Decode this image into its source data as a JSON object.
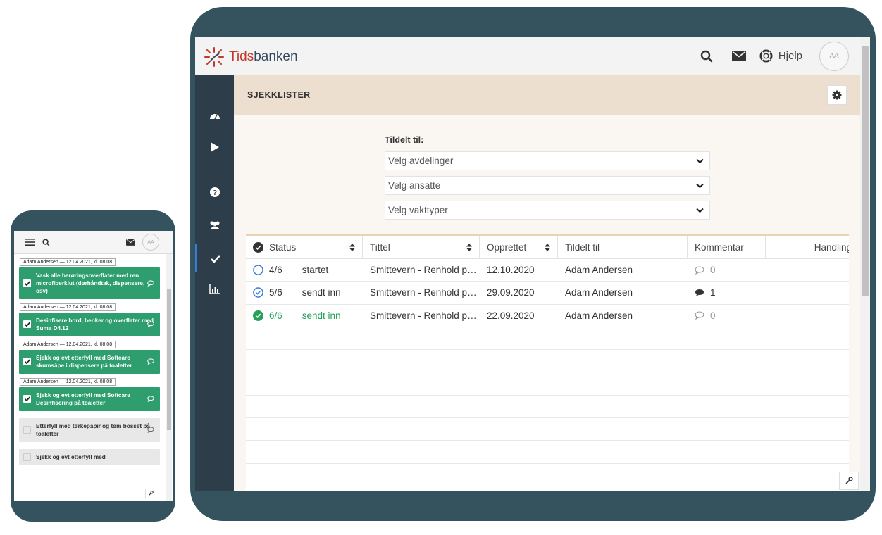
{
  "tablet": {
    "brand": {
      "part1": "Tids",
      "part2": "banken"
    },
    "topbar": {
      "search_icon": "search-icon",
      "mail_icon": "envelope-icon",
      "help_label": "Hjelp",
      "avatar": "AA"
    },
    "sidebar": [
      "dashboard-icon",
      "play-icon",
      "question-icon",
      "users-icon",
      "check-icon",
      "chart-icon"
    ],
    "page_title": "SJEKKLISTER",
    "filters": {
      "label": "Tildelt til:",
      "selects": [
        "Velg avdelinger",
        "Velg ansatte",
        "Velg vakttyper"
      ]
    },
    "table": {
      "headers": [
        "Status",
        "Tittel",
        "Opprettet",
        "Tildelt til",
        "Kommentar",
        "Handling"
      ],
      "rows": [
        {
          "progress": "4/6",
          "status": "startet",
          "title": "Smittevern - Renhold p…",
          "created": "12.10.2020",
          "assigned": "Adam Andersen",
          "comments": "0",
          "state": "started"
        },
        {
          "progress": "5/6",
          "status": "sendt inn",
          "title": "Smittevern - Renhold p…",
          "created": "29.09.2020",
          "assigned": "Adam Andersen",
          "comments": "1",
          "state": "submitted"
        },
        {
          "progress": "6/6",
          "status": "sendt inn",
          "title": "Smittevern - Renhold p…",
          "created": "22.09.2020",
          "assigned": "Adam Andersen",
          "comments": "0",
          "state": "complete"
        }
      ]
    },
    "colors": {
      "frame": "#35535f",
      "sidebar": "#2d3e4a",
      "header": "#ecdfcf",
      "green": "#27a05a",
      "accent": "#3a7bd5"
    }
  },
  "phone": {
    "avatar": "AA",
    "tasks": [
      {
        "meta": "Adam Andersen — 12.04.2021, kl. 08:08",
        "text": "Vask alle berøringsoverflater med ren microfiberklut (dørhåndtak, dispensere, osv)",
        "done": true
      },
      {
        "meta": "Adam Andersen — 12.04.2021, kl. 08:08",
        "text": "Desinfisere bord, benker og overflater med Suma D4.12",
        "done": true
      },
      {
        "meta": "Adam Andersen — 12.04.2021, kl. 08:08",
        "text": "Sjekk og evt etterfyll med Softcare skumsåpe i dispensere på toaletter",
        "done": true
      },
      {
        "meta": "Adam Andersen — 12.04.2021, kl. 08:08",
        "text": "Sjekk og evt etterfyll med Softcare Desinfisering på toaletter",
        "done": true
      },
      {
        "meta": "",
        "text": "Etterfyll med tørkepapir og tøm bosset på toaletter",
        "done": false
      },
      {
        "meta": "",
        "text": "Sjekk og evt etterfyll med",
        "done": false
      }
    ]
  }
}
